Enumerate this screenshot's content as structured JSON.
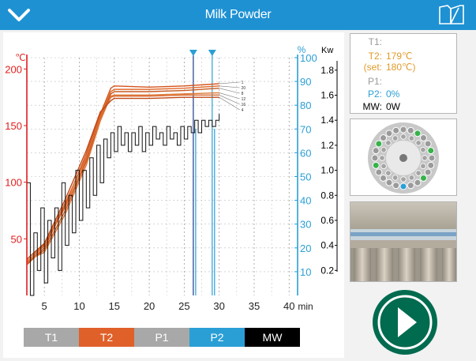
{
  "app": {
    "title": "Milk Powder"
  },
  "colors": {
    "accent": "#1e91d3",
    "t1": "#a8a8a8",
    "t2": "#e0602a",
    "t2_text": "#e09a2a",
    "p1": "#a8a8a8",
    "p2": "#2a9fd6",
    "mw": "#000000",
    "play": "#006b4f"
  },
  "readout": {
    "t1_label": "T1:",
    "t1_value": "",
    "t2_label": "T2:",
    "t2_value": "179℃",
    "set_label": "(set:",
    "set_value": "180℃)",
    "p1_label": "P1:",
    "p1_value": "",
    "p2_label": "P2:",
    "p2_value": "0%",
    "mw_label": "MW:",
    "mw_value": "0W"
  },
  "buttons": {
    "t1": "T1",
    "t2": "T2",
    "p1": "P1",
    "p2": "P2",
    "mw": "MW"
  },
  "chart_data": {
    "type": "line",
    "x_label": "min",
    "x_ticks": [
      5,
      10,
      15,
      20,
      25,
      30,
      35,
      40
    ],
    "xlim": [
      2.5,
      42
    ],
    "axes": [
      {
        "side": "left",
        "unit": "℃",
        "ticks": [
          50,
          100,
          150,
          200
        ],
        "range": [
          0,
          210
        ]
      },
      {
        "side": "right",
        "unit": "%",
        "ticks": [
          10,
          20,
          30,
          40,
          50,
          60,
          70,
          80,
          90,
          100
        ],
        "range": [
          0,
          100
        ]
      },
      {
        "side": "right",
        "unit": "Kw",
        "ticks": [
          "0.2",
          "0.4",
          "0.6",
          "0.8",
          "1.0",
          "1.2",
          "1.4",
          "1.6",
          "1.8"
        ],
        "range": [
          0,
          1.9
        ]
      }
    ],
    "temperature_curves": {
      "labels": [
        "1",
        "20",
        "8",
        "12",
        "16",
        "4"
      ],
      "x": [
        2.5,
        5,
        8,
        11,
        13,
        14.5,
        15,
        20,
        25,
        30
      ],
      "series": [
        {
          "values": [
            27,
            42,
            80,
            125,
            160,
            183,
            185,
            184,
            185,
            187
          ]
        },
        {
          "values": [
            30,
            45,
            78,
            120,
            158,
            180,
            182,
            182,
            183,
            185
          ]
        },
        {
          "values": [
            29,
            40,
            75,
            118,
            156,
            178,
            180,
            180,
            181,
            183
          ]
        },
        {
          "values": [
            31,
            38,
            72,
            115,
            154,
            176,
            177,
            177,
            178,
            179
          ]
        },
        {
          "values": [
            28,
            44,
            82,
            122,
            157,
            175,
            176,
            176,
            177,
            177
          ]
        },
        {
          "values": [
            32,
            46,
            85,
            128,
            162,
            172,
            174,
            174,
            175,
            175
          ]
        }
      ]
    },
    "power_trace": {
      "x": [
        2.5,
        3,
        3.5,
        4,
        4.5,
        5,
        5.5,
        6,
        6.5,
        7,
        7.5,
        8,
        8.5,
        9,
        9.5,
        10,
        10.5,
        11,
        11.5,
        12,
        12.5,
        13,
        13.5,
        14,
        14.5,
        15,
        15.5,
        16,
        16.5,
        17,
        17.5,
        18,
        18.5,
        19,
        19.5,
        20,
        20.5,
        21,
        21.5,
        22,
        22.5,
        23,
        23.5,
        24,
        24.5,
        25,
        25.5,
        26,
        26.5,
        27,
        27.5,
        28,
        28.5,
        29,
        29.5,
        30
      ],
      "values": [
        0.9,
        0.0,
        0.5,
        0.2,
        0.7,
        0.1,
        0.6,
        0.3,
        0.7,
        0.2,
        0.9,
        0.4,
        0.8,
        0.5,
        1.0,
        0.6,
        1.0,
        0.7,
        1.1,
        0.8,
        1.2,
        0.9,
        1.25,
        1.1,
        1.3,
        1.15,
        1.35,
        1.2,
        1.3,
        1.15,
        1.3,
        1.2,
        1.35,
        1.15,
        1.3,
        1.2,
        1.35,
        1.25,
        1.3,
        1.2,
        1.35,
        1.25,
        1.3,
        1.2,
        1.35,
        1.25,
        1.35,
        1.3,
        1.4,
        1.3,
        1.4,
        1.35,
        1.4,
        1.35,
        1.4,
        1.45
      ]
    },
    "markers_x": [
      26.3,
      29
    ]
  }
}
